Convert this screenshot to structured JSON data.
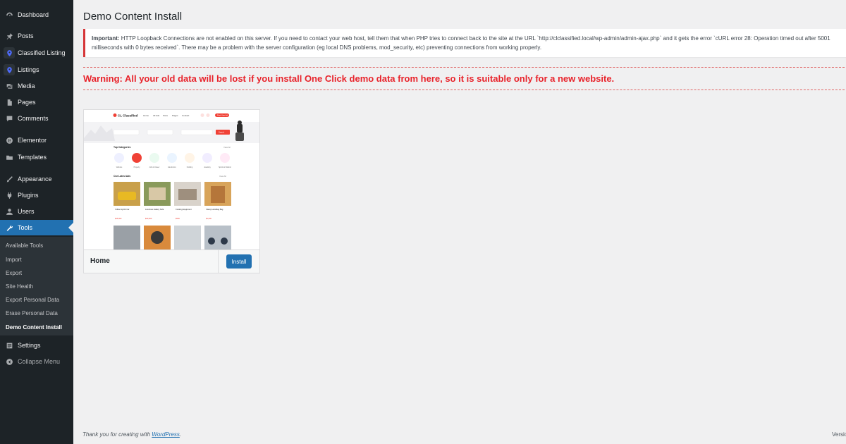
{
  "sidebar": {
    "items": [
      {
        "label": "Dashboard",
        "icon": "dashboard-icon"
      },
      {
        "label": "Posts",
        "icon": "pin-icon"
      },
      {
        "label": "Classified Listing",
        "icon": "location-pin-icon"
      },
      {
        "label": "Listings",
        "icon": "location-pin-icon"
      },
      {
        "label": "Media",
        "icon": "media-icon"
      },
      {
        "label": "Pages",
        "icon": "page-icon"
      },
      {
        "label": "Comments",
        "icon": "comment-icon"
      },
      {
        "label": "Elementor",
        "icon": "elementor-icon"
      },
      {
        "label": "Templates",
        "icon": "folder-icon"
      },
      {
        "label": "Appearance",
        "icon": "brush-icon"
      },
      {
        "label": "Plugins",
        "icon": "plugin-icon"
      },
      {
        "label": "Users",
        "icon": "user-icon"
      },
      {
        "label": "Tools",
        "icon": "wrench-icon"
      },
      {
        "label": "Settings",
        "icon": "settings-icon"
      },
      {
        "label": "Collapse Menu",
        "icon": "collapse-icon"
      }
    ],
    "submenu": [
      {
        "label": "Available Tools"
      },
      {
        "label": "Import"
      },
      {
        "label": "Export"
      },
      {
        "label": "Site Health"
      },
      {
        "label": "Export Personal Data"
      },
      {
        "label": "Erase Personal Data"
      },
      {
        "label": "Demo Content Install"
      }
    ]
  },
  "main": {
    "title": "Demo Content Install",
    "notice": {
      "strong": "Important:",
      "text": "HTTP Loopback Connections are not enabled on this server. If you need to contact your web host, tell them that when PHP tries to connect back to the site at the URL `http://clclassified.local/wp-admin/admin-ajax.php` and it gets the error `cURL error 28: Operation timed out after 5001 milliseconds with 0 bytes received`. There may be a problem with the server configuration (eg local DNS problems, mod_security, etc) preventing connections from working properly."
    },
    "warning": "Warning: All your old data will be lost if you install One Click demo data from here, so it is suitable only for a new website.",
    "demo": {
      "name": "Home",
      "install_label": "Install",
      "preview": {
        "brand": "CL Classified",
        "nav": [
          "Home",
          "All Ads",
          "Store",
          "Pages",
          "Contact"
        ],
        "post_button": "Post Your Ad",
        "search_button": "Search",
        "categories_heading": "Top Categories",
        "categories_link": "View All",
        "categories": [
          "Vehicles",
          "Property",
          "Jobs & Career",
          "Electronics",
          "Clothing",
          "Jewellery",
          "Sports & Outdoor"
        ],
        "latest_heading": "Our Latest Ads",
        "latest_link": "View All",
        "ads": [
          {
            "title": "Yellow Hybrid Car",
            "price": "$15,000"
          },
          {
            "title": "Luxurious Gallery Sofa",
            "price": "$20,000"
          },
          {
            "title": "Cooking Equipment",
            "price": "$500"
          },
          {
            "title": "Classy Handbag Bag",
            "price": "$1,000"
          }
        ]
      }
    }
  },
  "footer": {
    "thanks": "Thank you for creating with ",
    "link": "WordPress",
    "end": ".",
    "version": "Version"
  },
  "colors": {
    "sidebar_bg": "#1d2327",
    "accent": "#2271b1",
    "warning": "#e8232b",
    "notice_border": "#d63638"
  }
}
